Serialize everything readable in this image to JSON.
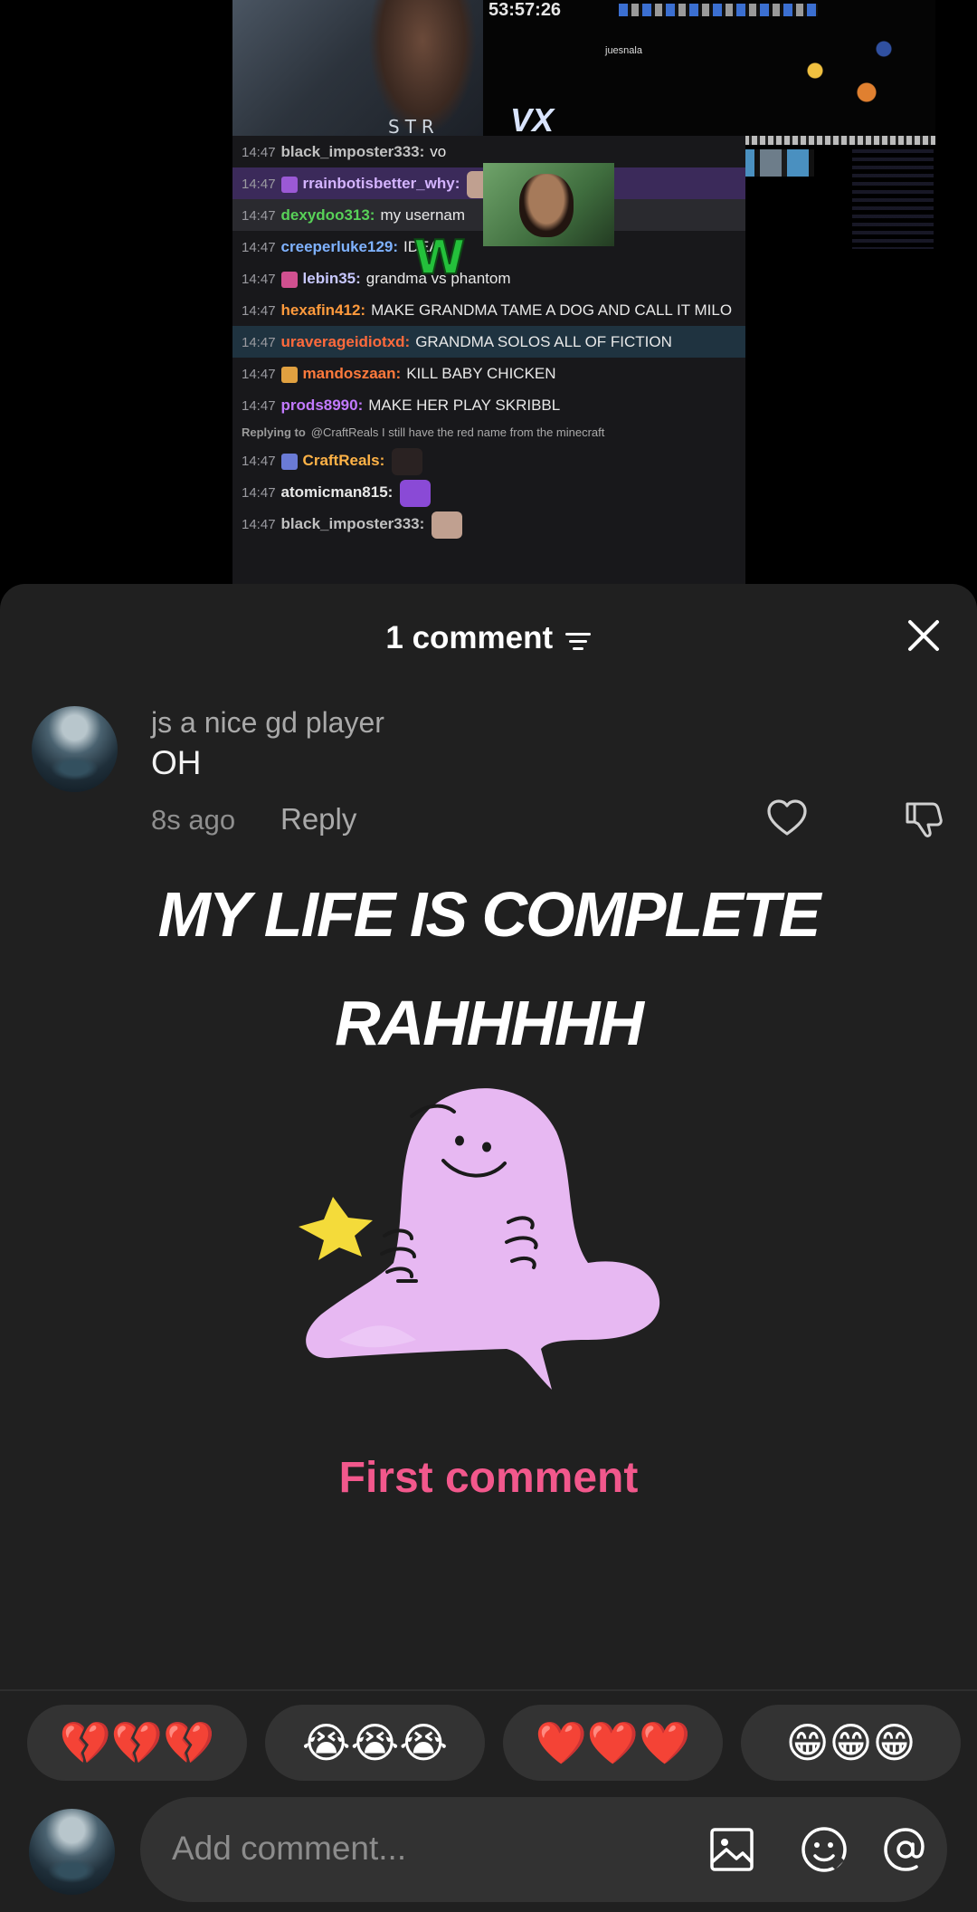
{
  "video": {
    "timer": "53:57:26",
    "game_label": "juesnala",
    "game_logo": "VX",
    "streamer_watermark": "STR",
    "w_emote": "W",
    "chat": [
      {
        "time": "14:47",
        "user": "black_imposter333:",
        "user_color": "#c0c0c0",
        "text": "vo",
        "style": ""
      },
      {
        "time": "14:47",
        "user": "rrainbotisbetter_why:",
        "user_color": "#d4b4ff",
        "text": "",
        "style": "hl-purple"
      },
      {
        "time": "14:47",
        "user": "dexydoo313:",
        "user_color": "#58d158",
        "text": "my usernam",
        "style": "hl-dark"
      },
      {
        "time": "14:47",
        "user": "creeperluke129:",
        "user_color": "#7fb2ff",
        "text": "IDEA",
        "style": ""
      },
      {
        "time": "14:47",
        "user": "lebin35:",
        "user_color": "#c8c8ff",
        "text": "grandma vs phantom",
        "style": ""
      },
      {
        "time": "14:47",
        "user": "hexafin412:",
        "user_color": "#ff9a3c",
        "text": "MAKE GRANDMA TAME A DOG AND CALL IT MILO",
        "style": ""
      },
      {
        "time": "14:47",
        "user": "uraverageidiotxd:",
        "user_color": "#ff6a3c",
        "text": "GRANDMA SOLOS ALL OF FICTION",
        "style": "hl-blue"
      },
      {
        "time": "14:47",
        "user": "mandoszaan:",
        "user_color": "#ff7a3c",
        "text": "KILL BABY CHICKEN",
        "style": ""
      },
      {
        "time": "14:47",
        "user": "prods8990:",
        "user_color": "#c27aff",
        "text": "MAKE HER PLAY SKRIBBL",
        "style": ""
      },
      {
        "time": "",
        "user": "Replying to",
        "user_color": "#9a9a9a",
        "text": "@CraftReals I still have the red name from the minecraft",
        "style": "reply"
      },
      {
        "time": "14:47",
        "user": "CraftReals:",
        "user_color": "#ffb347",
        "text": "",
        "style": ""
      },
      {
        "time": "14:47",
        "user": "atomicman815:",
        "user_color": "#e8e8e8",
        "text": "",
        "style": ""
      },
      {
        "time": "14:47",
        "user": "black_imposter333:",
        "user_color": "#c0c0c0",
        "text": "",
        "style": ""
      }
    ]
  },
  "sheet": {
    "title": "1 comment",
    "comment": {
      "username": "js a nice gd player",
      "text": "OH",
      "time": "8s ago",
      "reply_label": "Reply"
    },
    "overlay_line1": "MY LIFE IS COMPLETE",
    "overlay_line2": "RAHHHHH",
    "first_comment": "First comment",
    "reactions": [
      {
        "emoji": "💔💔💔"
      },
      {
        "emoji": "😭😭😭"
      },
      {
        "emoji": "❤️❤️❤️"
      },
      {
        "emoji": "😁😁😁"
      }
    ],
    "input_placeholder": "Add comment..."
  },
  "colors": {
    "sheet_bg": "#202020",
    "accent_pink": "#f2588c",
    "mascot_purple": "#e7b8f2"
  },
  "icons": [
    "filter-icon",
    "close-icon",
    "heart-icon",
    "dislike-icon",
    "image-icon",
    "emoji-icon",
    "mention-icon"
  ]
}
